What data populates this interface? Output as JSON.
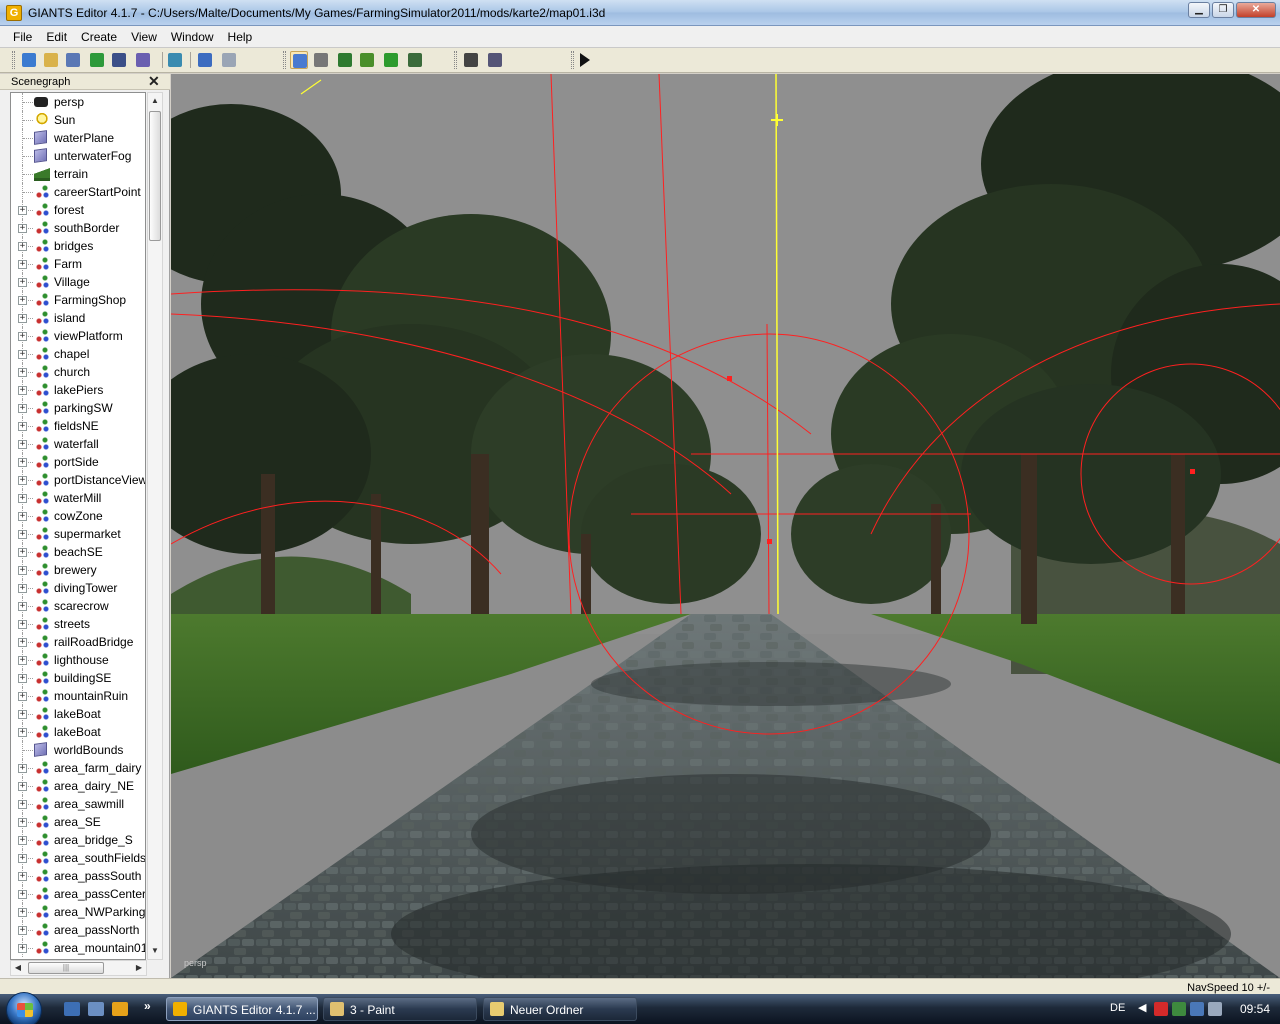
{
  "window": {
    "icon_letter": "G",
    "title": "GIANTS Editor 4.1.7 - C:/Users/Malte/Documents/My Games/FarmingSimulator2011/mods/karte2/map01.i3d",
    "buttons": {
      "minimize": "▁",
      "maximize": "❐",
      "close": "✕"
    }
  },
  "menu": [
    "File",
    "Edit",
    "Create",
    "View",
    "Window",
    "Help"
  ],
  "toolbar": {
    "buttons": [
      {
        "name": "new-icon",
        "color": "#3b7bd0"
      },
      {
        "name": "open-icon",
        "color": "#d9b24a"
      },
      {
        "name": "list-icon",
        "color": "#5a78b5"
      },
      {
        "name": "reload-icon",
        "color": "#2e9a3a"
      },
      {
        "name": "save-icon",
        "color": "#3b4f88"
      },
      {
        "name": "save-all-icon",
        "color": "#6a5fb0"
      },
      {
        "name": "export-icon",
        "color": "#3a8bb0"
      },
      {
        "name": "undo-icon",
        "color": "#3c6cc0"
      },
      {
        "name": "redo-icon",
        "color": "#9aa5b5"
      },
      {
        "name": "select-tool-icon",
        "color": "#4a7ad0"
      },
      {
        "name": "magnet-icon",
        "color": "#777777"
      },
      {
        "name": "terrain-sculpt-icon",
        "color": "#2f7a2f"
      },
      {
        "name": "terrain-paint-icon",
        "color": "#4a8f2a"
      },
      {
        "name": "foliage-paint-icon",
        "color": "#2d9b2d"
      },
      {
        "name": "info-layer-icon",
        "color": "#3b6b3b"
      },
      {
        "name": "grid-icon",
        "color": "#444444"
      },
      {
        "name": "snap-icon",
        "color": "#555577"
      },
      {
        "name": "play-icon",
        "color": "#111111"
      }
    ]
  },
  "scenegraph": {
    "title": "Scenegraph",
    "close": "✕",
    "nodes": [
      {
        "label": "persp",
        "icon": "camera",
        "expandable": false
      },
      {
        "label": "Sun",
        "icon": "light",
        "expandable": false
      },
      {
        "label": "waterPlane",
        "icon": "shape",
        "expandable": false
      },
      {
        "label": "unterwaterFog",
        "icon": "shape",
        "expandable": false
      },
      {
        "label": "terrain",
        "icon": "terrain",
        "expandable": false
      },
      {
        "label": "careerStartPoint",
        "icon": "group",
        "expandable": false
      },
      {
        "label": "forest",
        "icon": "group",
        "expandable": true
      },
      {
        "label": "southBorder",
        "icon": "group",
        "expandable": true
      },
      {
        "label": "bridges",
        "icon": "group",
        "expandable": true
      },
      {
        "label": "Farm",
        "icon": "group",
        "expandable": true
      },
      {
        "label": "Village",
        "icon": "group",
        "expandable": true
      },
      {
        "label": "FarmingShop",
        "icon": "group",
        "expandable": true
      },
      {
        "label": "island",
        "icon": "group",
        "expandable": true
      },
      {
        "label": "viewPlatform",
        "icon": "group",
        "expandable": true
      },
      {
        "label": "chapel",
        "icon": "group",
        "expandable": true
      },
      {
        "label": "church",
        "icon": "group",
        "expandable": true
      },
      {
        "label": "lakePiers",
        "icon": "group",
        "expandable": true
      },
      {
        "label": "parkingSW",
        "icon": "group",
        "expandable": true
      },
      {
        "label": "fieldsNE",
        "icon": "group",
        "expandable": true
      },
      {
        "label": "waterfall",
        "icon": "group",
        "expandable": true
      },
      {
        "label": "portSide",
        "icon": "group",
        "expandable": true
      },
      {
        "label": "portDistanceView",
        "icon": "group",
        "expandable": true
      },
      {
        "label": "waterMill",
        "icon": "group",
        "expandable": true
      },
      {
        "label": "cowZone",
        "icon": "group",
        "expandable": true
      },
      {
        "label": "supermarket",
        "icon": "group",
        "expandable": true
      },
      {
        "label": "beachSE",
        "icon": "group",
        "expandable": true
      },
      {
        "label": "brewery",
        "icon": "group",
        "expandable": true
      },
      {
        "label": "divingTower",
        "icon": "group",
        "expandable": true
      },
      {
        "label": "scarecrow",
        "icon": "group",
        "expandable": true
      },
      {
        "label": "streets",
        "icon": "group",
        "expandable": true
      },
      {
        "label": "railRoadBridge",
        "icon": "group",
        "expandable": true
      },
      {
        "label": "lighthouse",
        "icon": "group",
        "expandable": true
      },
      {
        "label": "buildingSE",
        "icon": "group",
        "expandable": true
      },
      {
        "label": "mountainRuin",
        "icon": "group",
        "expandable": true
      },
      {
        "label": "lakeBoat",
        "icon": "group",
        "expandable": true
      },
      {
        "label": "lakeBoat",
        "icon": "group",
        "expandable": true
      },
      {
        "label": "worldBounds",
        "icon": "shape",
        "expandable": false
      },
      {
        "label": "area_farm_dairy",
        "icon": "group",
        "expandable": true
      },
      {
        "label": "area_dairy_NE",
        "icon": "group",
        "expandable": true
      },
      {
        "label": "area_sawmill",
        "icon": "group",
        "expandable": true
      },
      {
        "label": "area_SE",
        "icon": "group",
        "expandable": true
      },
      {
        "label": "area_bridge_S",
        "icon": "group",
        "expandable": true
      },
      {
        "label": "area_southFieldsN",
        "icon": "group",
        "expandable": true
      },
      {
        "label": "area_passSouth",
        "icon": "group",
        "expandable": true
      },
      {
        "label": "area_passCenter",
        "icon": "group",
        "expandable": true
      },
      {
        "label": "area_NWParking",
        "icon": "group",
        "expandable": true
      },
      {
        "label": "area_passNorth",
        "icon": "group",
        "expandable": true
      },
      {
        "label": "area_mountain01",
        "icon": "group",
        "expandable": true
      }
    ],
    "scroll_up": "▲",
    "scroll_down": "▼",
    "scroll_left": "◀",
    "scroll_right": "▶",
    "hthumb_grip": "|||"
  },
  "viewport": {
    "camera_label": "persp",
    "sky_color": "#8f8f8f",
    "helper_color": "#ff2020",
    "axis_color": "#ffff33"
  },
  "status": {
    "nav_speed": "NavSpeed 10 +/-"
  },
  "taskbar": {
    "quick_launch_more": "»",
    "tasks": [
      {
        "label": "GIANTS Editor 4.1.7 ...",
        "active": true,
        "icon_color": "#f0b000"
      },
      {
        "label": "3 - Paint",
        "active": false,
        "icon_color": "#e0c070"
      },
      {
        "label": "Neuer Ordner",
        "active": false,
        "icon_color": "#e8cc70"
      }
    ],
    "language": "DE",
    "tray_arrow": "◀",
    "clock": "09:54"
  }
}
